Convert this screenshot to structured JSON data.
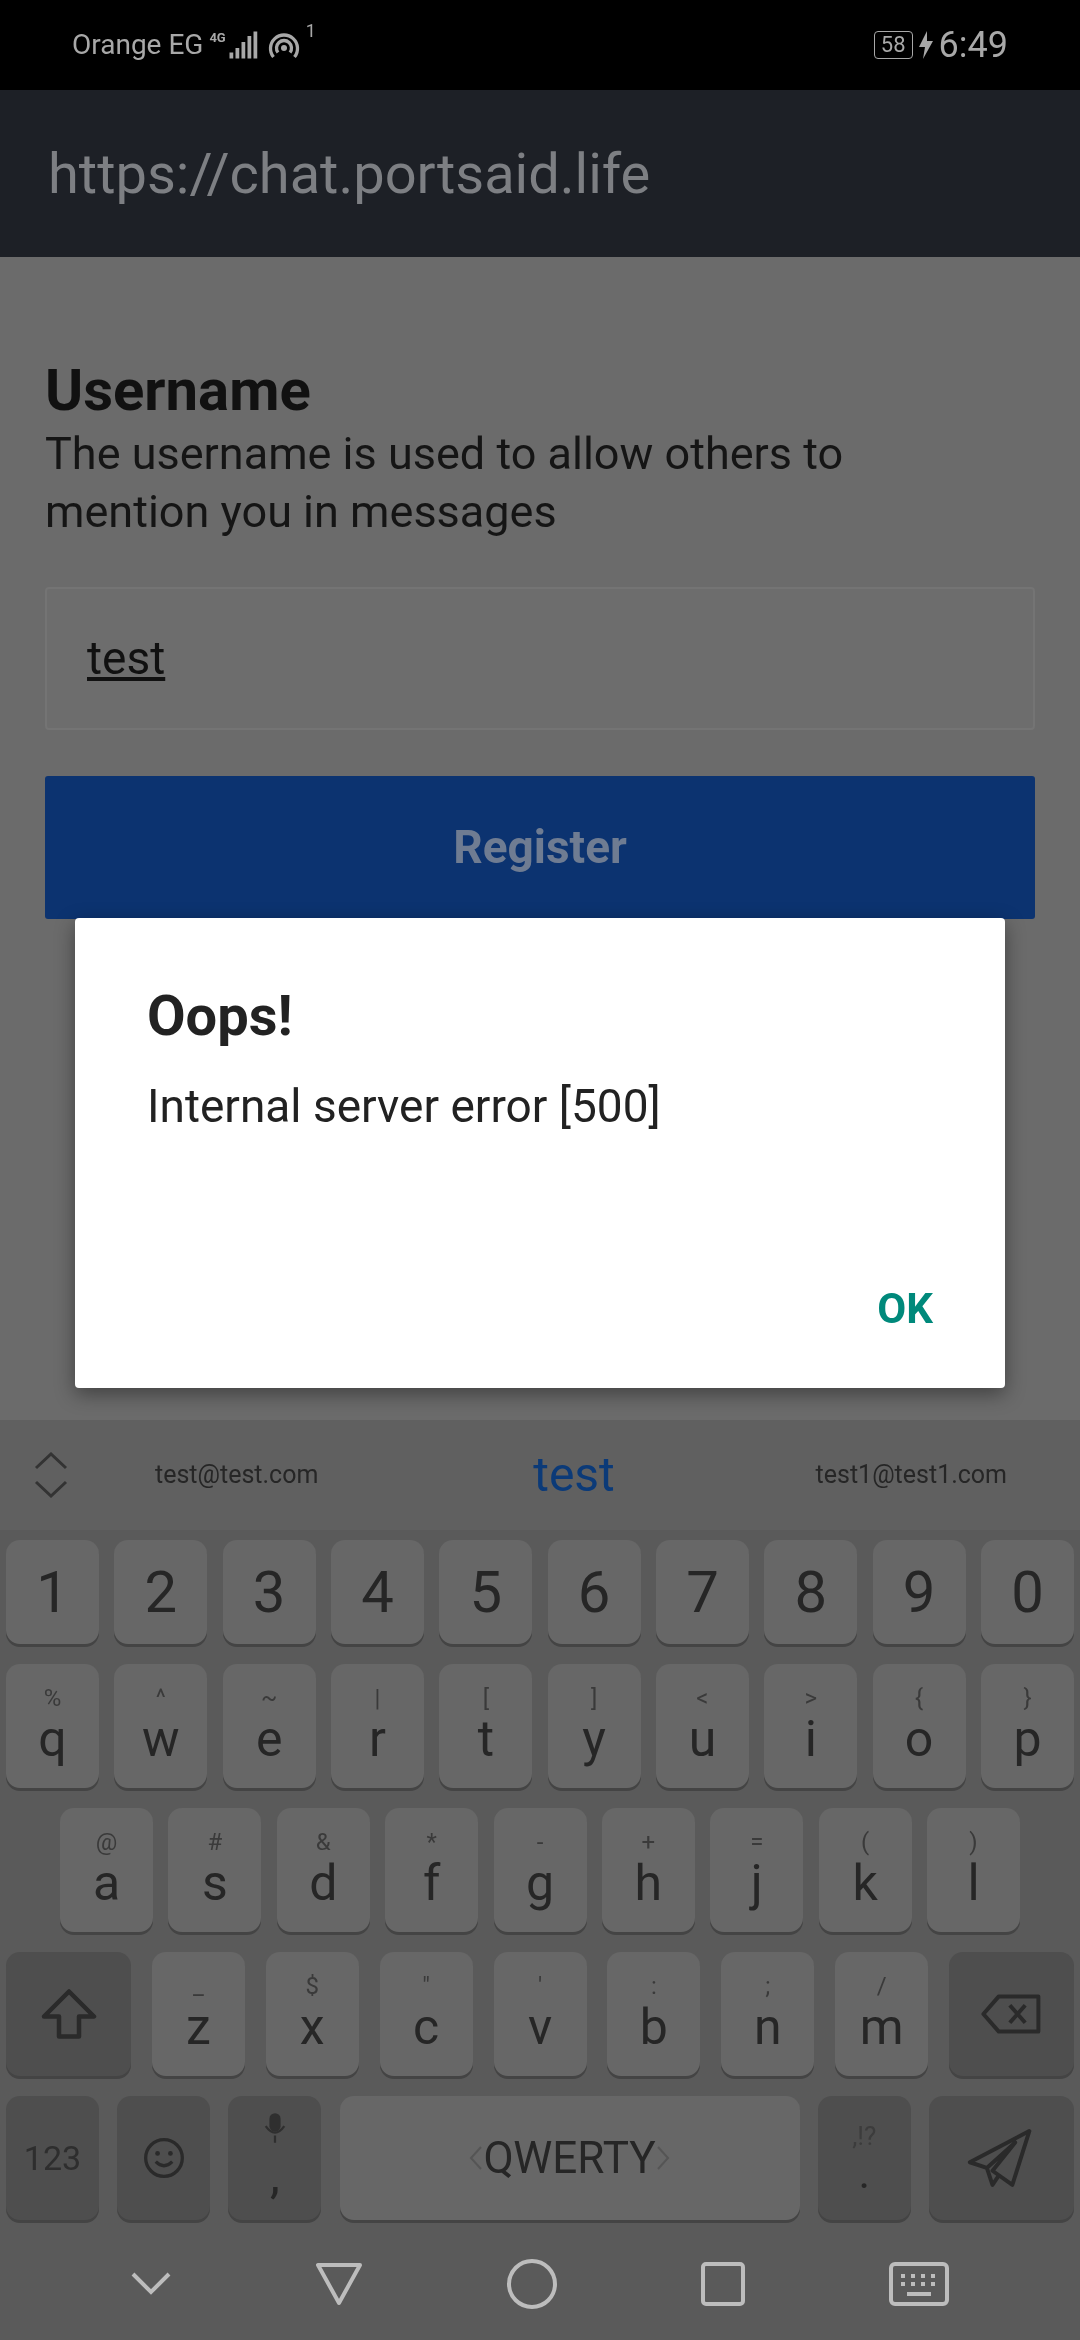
{
  "status_bar": {
    "carrier": "Orange EG",
    "network": "4G",
    "sim": "1",
    "battery": "58",
    "time": "6:49"
  },
  "url_bar": {
    "url": "https://chat.portsaid.life"
  },
  "form": {
    "title": "Username",
    "description": "The username is used to allow others to mention you in messages",
    "field": {
      "value": "test"
    },
    "button": "Register"
  },
  "dialog": {
    "title": "Oops!",
    "message": "Internal server error [500]",
    "button": "OK"
  },
  "keyboard": {
    "suggestions": [
      {
        "text": "test@test.com",
        "selected": false
      },
      {
        "text": "test",
        "selected": true
      },
      {
        "text": "test1@test1.com",
        "selected": false
      }
    ],
    "rows": [
      {
        "keys": [
          {
            "kind": "char",
            "label": "1"
          },
          {
            "kind": "char",
            "label": "2"
          },
          {
            "kind": "char",
            "label": "3"
          },
          {
            "kind": "char",
            "label": "4"
          },
          {
            "kind": "char",
            "label": "5"
          },
          {
            "kind": "char",
            "label": "6"
          },
          {
            "kind": "char",
            "label": "7"
          },
          {
            "kind": "char",
            "label": "8"
          },
          {
            "kind": "char",
            "label": "9"
          },
          {
            "kind": "char",
            "label": "0"
          }
        ]
      },
      {
        "keys": [
          {
            "kind": "char",
            "label": "q",
            "hint": "%"
          },
          {
            "kind": "char",
            "label": "w",
            "hint": "^"
          },
          {
            "kind": "char",
            "label": "e",
            "hint": "~"
          },
          {
            "kind": "char",
            "label": "r",
            "hint": "|"
          },
          {
            "kind": "char",
            "label": "t",
            "hint": "["
          },
          {
            "kind": "char",
            "label": "y",
            "hint": "]"
          },
          {
            "kind": "char",
            "label": "u",
            "hint": "<"
          },
          {
            "kind": "char",
            "label": "i",
            "hint": ">"
          },
          {
            "kind": "char",
            "label": "o",
            "hint": "{"
          },
          {
            "kind": "char",
            "label": "p",
            "hint": "}"
          }
        ]
      },
      {
        "keys": [
          {
            "kind": "char",
            "label": "a",
            "hint": "@"
          },
          {
            "kind": "char",
            "label": "s",
            "hint": "#"
          },
          {
            "kind": "char",
            "label": "d",
            "hint": "&"
          },
          {
            "kind": "char",
            "label": "f",
            "hint": "*"
          },
          {
            "kind": "char",
            "label": "g",
            "hint": "-"
          },
          {
            "kind": "char",
            "label": "h",
            "hint": "+"
          },
          {
            "kind": "char",
            "label": "j",
            "hint": "="
          },
          {
            "kind": "char",
            "label": "k",
            "hint": "("
          },
          {
            "kind": "char",
            "label": "l",
            "hint": ")"
          }
        ]
      },
      {
        "keys": [
          {
            "kind": "shift"
          },
          {
            "kind": "char",
            "label": "z",
            "hint": "_"
          },
          {
            "kind": "char",
            "label": "x",
            "hint": "$"
          },
          {
            "kind": "char",
            "label": "c",
            "hint": "\""
          },
          {
            "kind": "char",
            "label": "v",
            "hint": "'"
          },
          {
            "kind": "char",
            "label": "b",
            "hint": ":"
          },
          {
            "kind": "char",
            "label": "n",
            "hint": ";"
          },
          {
            "kind": "char",
            "label": "m",
            "hint": "/"
          },
          {
            "kind": "backspace"
          }
        ]
      },
      {
        "keys": [
          {
            "kind": "symbols",
            "label": "123"
          },
          {
            "kind": "emoji"
          },
          {
            "kind": "comma",
            "label": ","
          },
          {
            "kind": "space",
            "label": "QWERTY"
          },
          {
            "kind": "period",
            "label": ".",
            "hint": ",!?"
          },
          {
            "kind": "send"
          }
        ]
      }
    ]
  }
}
